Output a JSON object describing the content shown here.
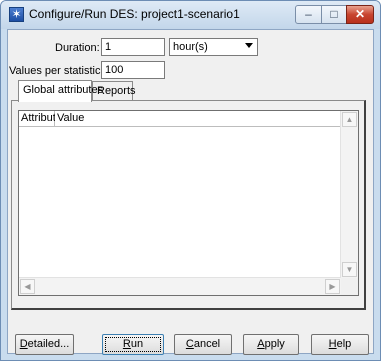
{
  "window": {
    "title": "Configure/Run DES: project1-scenario1",
    "controls": {
      "minimize": "–",
      "maximize": "□",
      "close": "✕"
    }
  },
  "form": {
    "duration_label": "Duration:",
    "duration_value": "1",
    "duration_unit": "hour(s)",
    "values_label": "Values per statistic:",
    "values_value": "100"
  },
  "tabs": [
    {
      "label": "Global attributes",
      "active": true
    },
    {
      "label": "Reports",
      "active": false
    }
  ],
  "table": {
    "columns": [
      "Attribute",
      "Value"
    ],
    "rows": []
  },
  "buttons": {
    "detailed": {
      "pre": "",
      "key": "D",
      "post": "etailed..."
    },
    "run": {
      "pre": "",
      "key": "R",
      "post": "un"
    },
    "cancel": {
      "pre": "",
      "key": "C",
      "post": "ancel"
    },
    "apply": {
      "pre": "",
      "key": "A",
      "post": "pply"
    },
    "help": {
      "pre": "",
      "key": "H",
      "post": "elp"
    }
  },
  "icons": {
    "app": "des-star-icon",
    "scroll_up": "▲",
    "scroll_down": "▼",
    "scroll_left": "◀",
    "scroll_right": "▶"
  },
  "colors": {
    "title_bar": "#c9dcee",
    "close_button": "#c84530",
    "default_button_border": "#3c7fb1"
  }
}
